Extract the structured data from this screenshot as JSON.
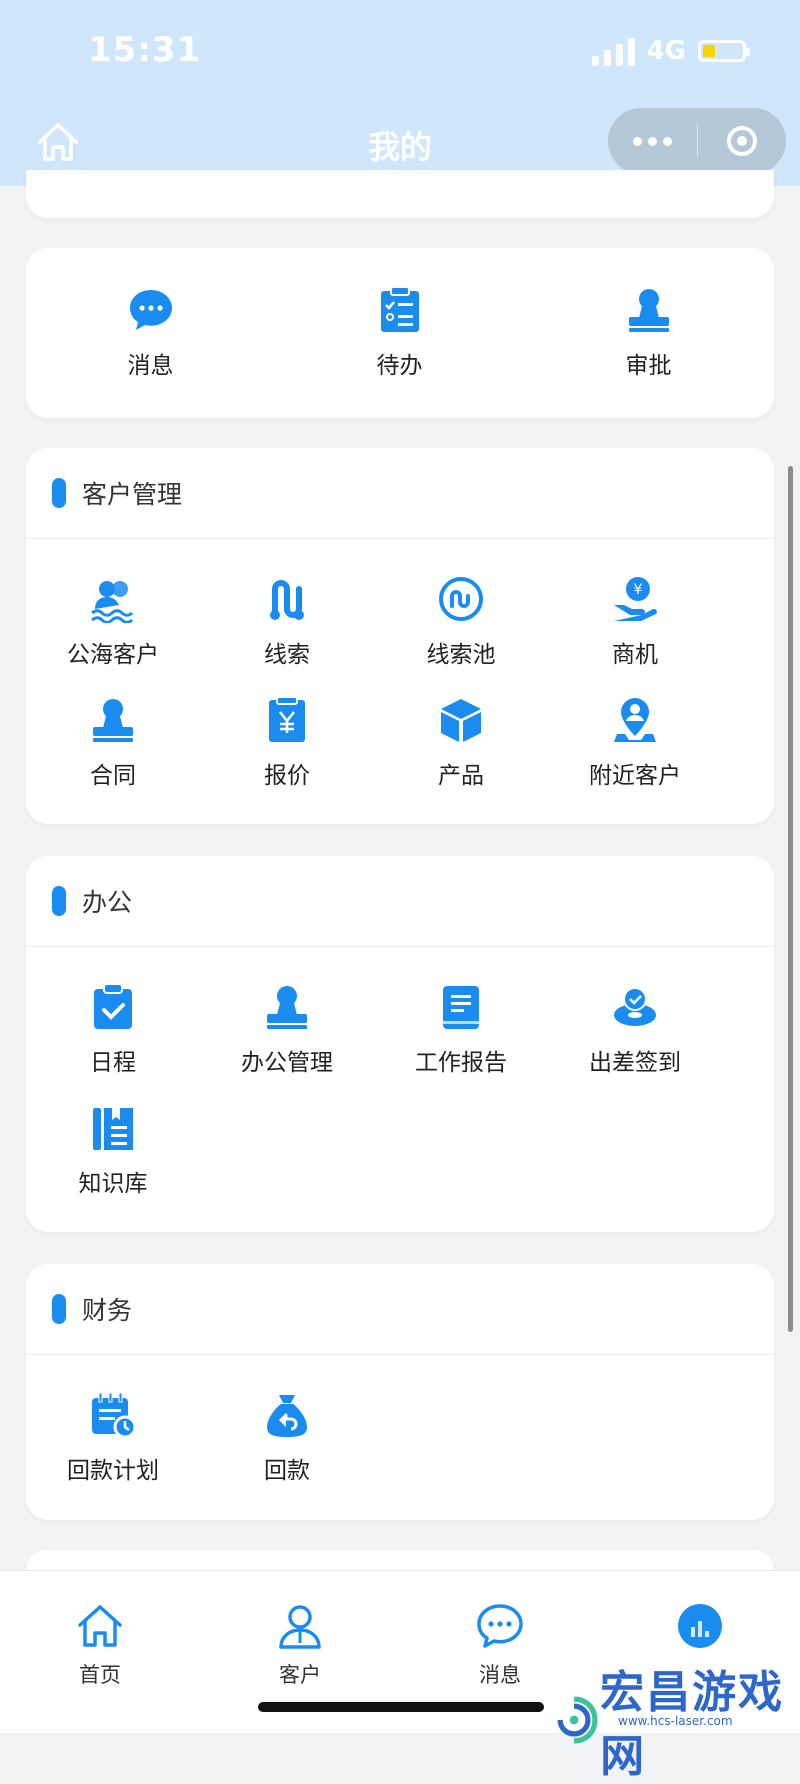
{
  "status": {
    "time": "15:31",
    "network": "4G"
  },
  "nav": {
    "title": "我的"
  },
  "colors": {
    "accent": "#1a8cf0",
    "topbar": "#cfe6fb"
  },
  "quick": [
    {
      "label": "消息",
      "icon": "chat-bubble-icon"
    },
    {
      "label": "待办",
      "icon": "clipboard-list-icon"
    },
    {
      "label": "审批",
      "icon": "stamp-icon"
    }
  ],
  "customer": {
    "title": "客户管理",
    "items": [
      {
        "label": "公海客户",
        "icon": "people-wave-icon"
      },
      {
        "label": "线索",
        "icon": "route-icon"
      },
      {
        "label": "线索池",
        "icon": "pool-icon"
      },
      {
        "label": "商机",
        "icon": "yen-hand-icon"
      },
      {
        "label": "合同",
        "icon": "stamp-icon"
      },
      {
        "label": "报价",
        "icon": "yen-document-icon"
      },
      {
        "label": "产品",
        "icon": "box-icon"
      },
      {
        "label": "附近客户",
        "icon": "location-person-icon"
      }
    ]
  },
  "office": {
    "title": "办公",
    "items": [
      {
        "label": "日程",
        "icon": "clipboard-check-icon"
      },
      {
        "label": "办公管理",
        "icon": "stamp-icon"
      },
      {
        "label": "工作报告",
        "icon": "report-book-icon"
      },
      {
        "label": "出差签到",
        "icon": "checkin-pin-icon"
      },
      {
        "label": "知识库",
        "icon": "library-icon"
      }
    ]
  },
  "finance": {
    "title": "财务",
    "items": [
      {
        "label": "回款计划",
        "icon": "calendar-clock-icon"
      },
      {
        "label": "回款",
        "icon": "money-bag-icon"
      }
    ]
  },
  "tabs": [
    {
      "label": "首页",
      "icon": "home-icon"
    },
    {
      "label": "客户",
      "icon": "user-icon"
    },
    {
      "label": "消息",
      "icon": "chat-bubble-icon"
    }
  ],
  "watermark": {
    "text": "宏昌游戏网",
    "sub": "www.hcs-laser.com"
  }
}
